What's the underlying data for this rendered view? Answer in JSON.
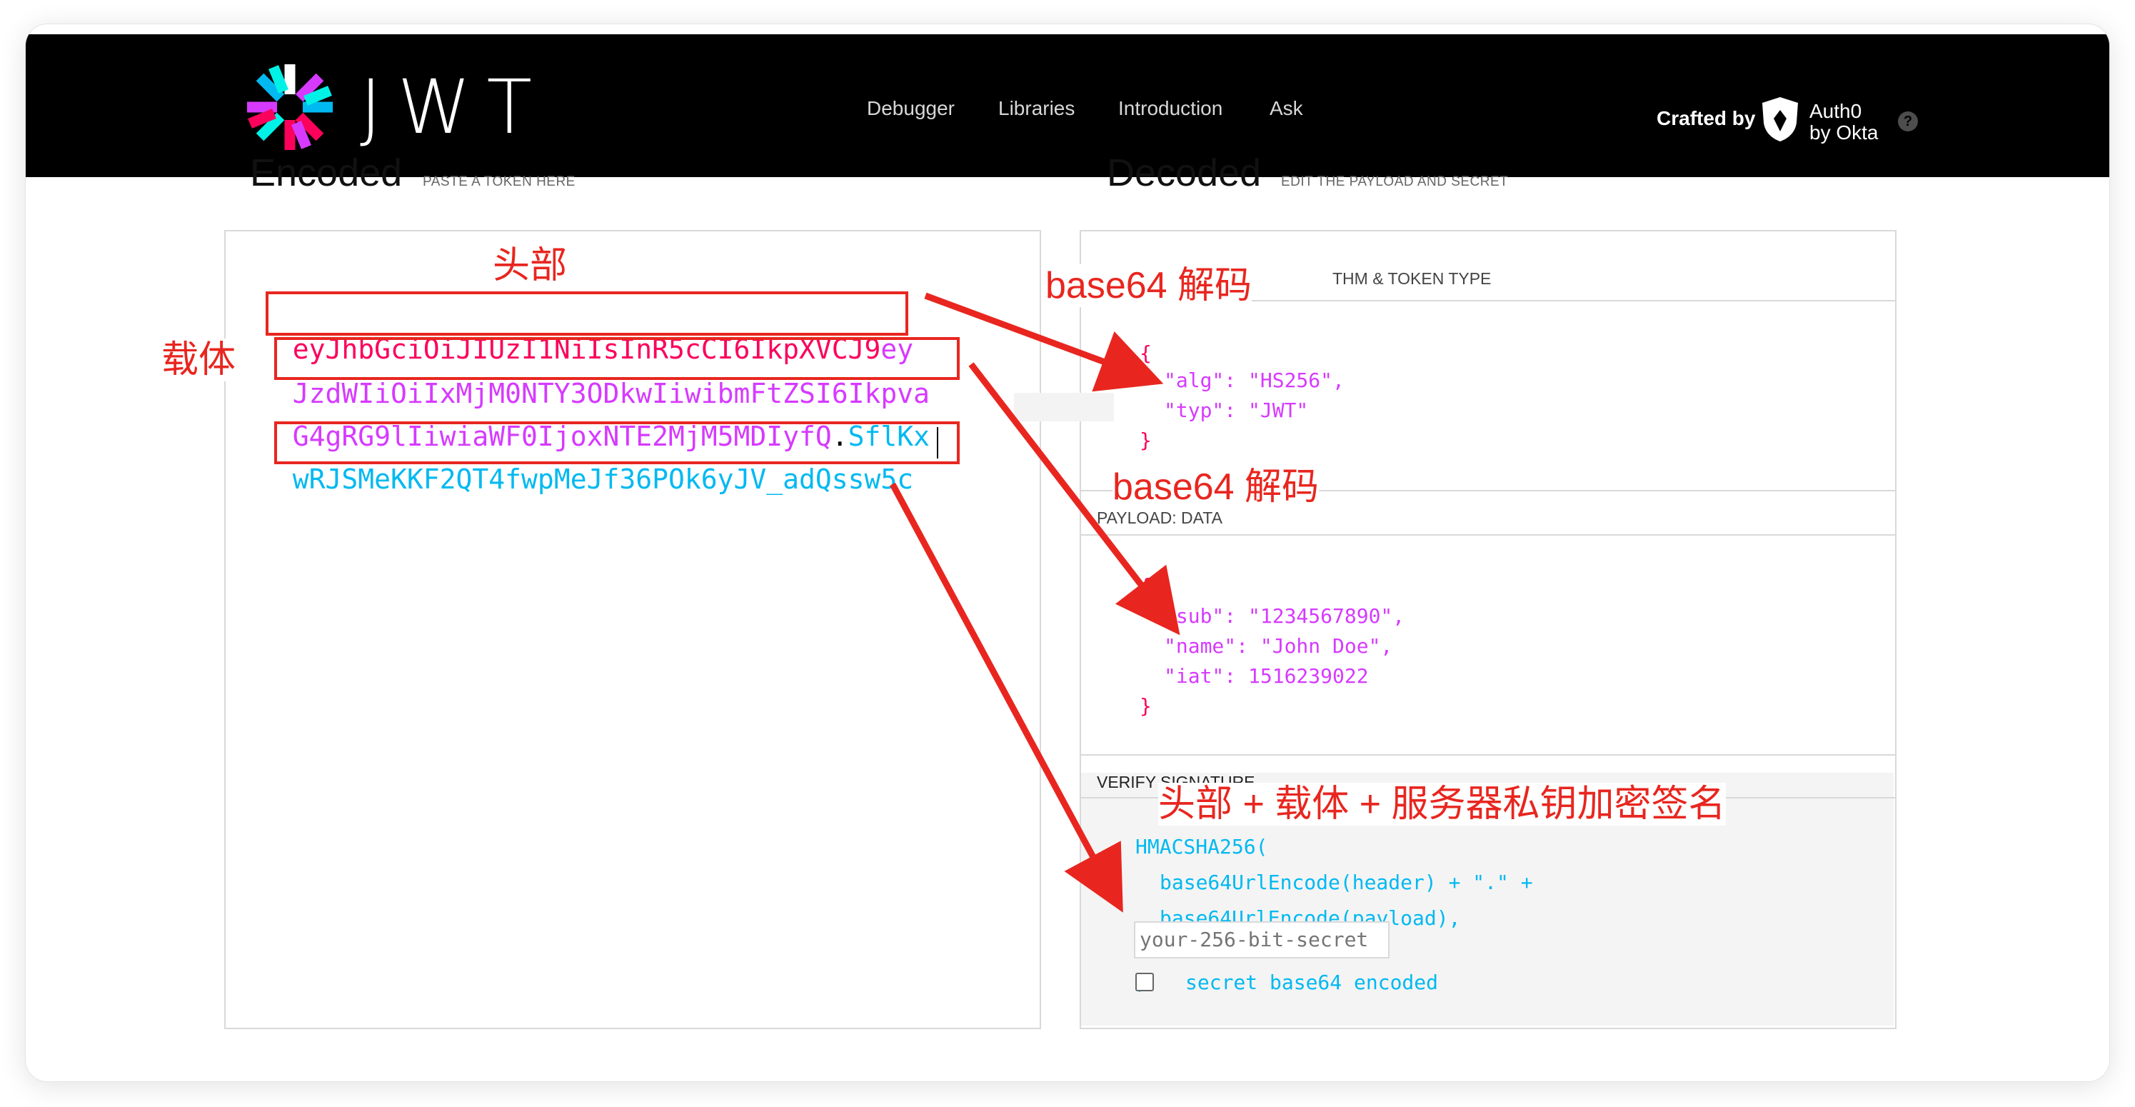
{
  "nav": {
    "logo_text": "JWT",
    "items": [
      {
        "label": "Debugger"
      },
      {
        "label": "Libraries"
      },
      {
        "label": "Introduction"
      },
      {
        "label": "Ask"
      }
    ],
    "crafted_by": "Crafted by",
    "brand_line1": "Auth0",
    "brand_line2": "by Okta",
    "help": "?"
  },
  "encoded": {
    "title": "Encoded",
    "subtitle": "PASTE A TOKEN HERE",
    "token_lines": [
      {
        "parts": [
          {
            "text": "eyJhbGciOiJIUzI1NiIsInR5cCI6IkpXVCJ9",
            "kind": "header"
          },
          {
            "text": "ey",
            "kind": "payload"
          }
        ]
      },
      {
        "parts": [
          {
            "text": "JzdWIiOiIxMjM0NTY3ODkwIiwibmFtZSI6Ikpva",
            "kind": "payload"
          }
        ]
      },
      {
        "parts": [
          {
            "text": "G4gRG9lIiwiaWF0IjoxNTE2MjM5MDIyfQ",
            "kind": "payload"
          },
          {
            "text": ".",
            "kind": "dot"
          },
          {
            "text": "SflKx",
            "kind": "signature"
          }
        ]
      },
      {
        "parts": [
          {
            "text": "wRJSMeKKF2QT4fwpMeJf36POk6yJV_adQssw5c",
            "kind": "signature"
          }
        ]
      }
    ]
  },
  "decoded": {
    "title": "Decoded",
    "subtitle": "EDIT THE PAYLOAD AND SECRET",
    "header_section": {
      "label": "THM & TOKEN TYPE",
      "json_open": "{",
      "lines": [
        "\"alg\": \"HS256\",",
        "\"typ\": \"JWT\""
      ],
      "json_close": "}"
    },
    "payload_section": {
      "label": "PAYLOAD: DATA",
      "json_open": "{",
      "lines": [
        "\"sub\": \"1234567890\",",
        "\"name\": \"John Doe\",",
        "\"iat\": 1516239022"
      ],
      "json_close": "}"
    },
    "verify_section": {
      "label": "VERIFY SIGNATURE",
      "fn": "HMACSHA256(",
      "line1": "base64UrlEncode(header) + \".\" +",
      "line2": "base64UrlEncode(payload),",
      "secret_placeholder": "your-256-bit-secret",
      "close": ")",
      "checkbox_label": "secret base64 encoded"
    }
  },
  "annotations": {
    "header_label": "头部",
    "payload_label": "载体",
    "decode_label_1": "base64 解码",
    "decode_label_2": "base64 解码",
    "signature_label": "头部 + 载体 + 服务器私钥加密签名",
    "color": "#e8261f"
  },
  "colors": {
    "header": "#fb015b",
    "payload": "#d63aff",
    "signature": "#00b9f1"
  }
}
